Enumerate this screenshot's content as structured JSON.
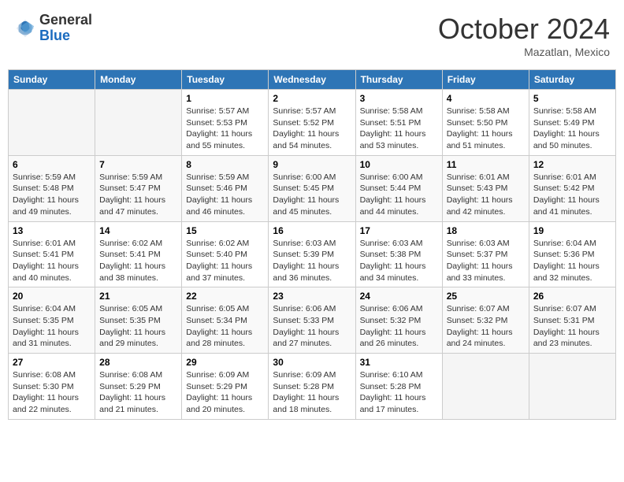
{
  "header": {
    "logo_general": "General",
    "logo_blue": "Blue",
    "month": "October 2024",
    "location": "Mazatlan, Mexico"
  },
  "columns": [
    "Sunday",
    "Monday",
    "Tuesday",
    "Wednesday",
    "Thursday",
    "Friday",
    "Saturday"
  ],
  "weeks": [
    [
      {
        "day": "",
        "info": ""
      },
      {
        "day": "",
        "info": ""
      },
      {
        "day": "1",
        "info": "Sunrise: 5:57 AM\nSunset: 5:53 PM\nDaylight: 11 hours and 55 minutes."
      },
      {
        "day": "2",
        "info": "Sunrise: 5:57 AM\nSunset: 5:52 PM\nDaylight: 11 hours and 54 minutes."
      },
      {
        "day": "3",
        "info": "Sunrise: 5:58 AM\nSunset: 5:51 PM\nDaylight: 11 hours and 53 minutes."
      },
      {
        "day": "4",
        "info": "Sunrise: 5:58 AM\nSunset: 5:50 PM\nDaylight: 11 hours and 51 minutes."
      },
      {
        "day": "5",
        "info": "Sunrise: 5:58 AM\nSunset: 5:49 PM\nDaylight: 11 hours and 50 minutes."
      }
    ],
    [
      {
        "day": "6",
        "info": "Sunrise: 5:59 AM\nSunset: 5:48 PM\nDaylight: 11 hours and 49 minutes."
      },
      {
        "day": "7",
        "info": "Sunrise: 5:59 AM\nSunset: 5:47 PM\nDaylight: 11 hours and 47 minutes."
      },
      {
        "day": "8",
        "info": "Sunrise: 5:59 AM\nSunset: 5:46 PM\nDaylight: 11 hours and 46 minutes."
      },
      {
        "day": "9",
        "info": "Sunrise: 6:00 AM\nSunset: 5:45 PM\nDaylight: 11 hours and 45 minutes."
      },
      {
        "day": "10",
        "info": "Sunrise: 6:00 AM\nSunset: 5:44 PM\nDaylight: 11 hours and 44 minutes."
      },
      {
        "day": "11",
        "info": "Sunrise: 6:01 AM\nSunset: 5:43 PM\nDaylight: 11 hours and 42 minutes."
      },
      {
        "day": "12",
        "info": "Sunrise: 6:01 AM\nSunset: 5:42 PM\nDaylight: 11 hours and 41 minutes."
      }
    ],
    [
      {
        "day": "13",
        "info": "Sunrise: 6:01 AM\nSunset: 5:41 PM\nDaylight: 11 hours and 40 minutes."
      },
      {
        "day": "14",
        "info": "Sunrise: 6:02 AM\nSunset: 5:41 PM\nDaylight: 11 hours and 38 minutes."
      },
      {
        "day": "15",
        "info": "Sunrise: 6:02 AM\nSunset: 5:40 PM\nDaylight: 11 hours and 37 minutes."
      },
      {
        "day": "16",
        "info": "Sunrise: 6:03 AM\nSunset: 5:39 PM\nDaylight: 11 hours and 36 minutes."
      },
      {
        "day": "17",
        "info": "Sunrise: 6:03 AM\nSunset: 5:38 PM\nDaylight: 11 hours and 34 minutes."
      },
      {
        "day": "18",
        "info": "Sunrise: 6:03 AM\nSunset: 5:37 PM\nDaylight: 11 hours and 33 minutes."
      },
      {
        "day": "19",
        "info": "Sunrise: 6:04 AM\nSunset: 5:36 PM\nDaylight: 11 hours and 32 minutes."
      }
    ],
    [
      {
        "day": "20",
        "info": "Sunrise: 6:04 AM\nSunset: 5:35 PM\nDaylight: 11 hours and 31 minutes."
      },
      {
        "day": "21",
        "info": "Sunrise: 6:05 AM\nSunset: 5:35 PM\nDaylight: 11 hours and 29 minutes."
      },
      {
        "day": "22",
        "info": "Sunrise: 6:05 AM\nSunset: 5:34 PM\nDaylight: 11 hours and 28 minutes."
      },
      {
        "day": "23",
        "info": "Sunrise: 6:06 AM\nSunset: 5:33 PM\nDaylight: 11 hours and 27 minutes."
      },
      {
        "day": "24",
        "info": "Sunrise: 6:06 AM\nSunset: 5:32 PM\nDaylight: 11 hours and 26 minutes."
      },
      {
        "day": "25",
        "info": "Sunrise: 6:07 AM\nSunset: 5:32 PM\nDaylight: 11 hours and 24 minutes."
      },
      {
        "day": "26",
        "info": "Sunrise: 6:07 AM\nSunset: 5:31 PM\nDaylight: 11 hours and 23 minutes."
      }
    ],
    [
      {
        "day": "27",
        "info": "Sunrise: 6:08 AM\nSunset: 5:30 PM\nDaylight: 11 hours and 22 minutes."
      },
      {
        "day": "28",
        "info": "Sunrise: 6:08 AM\nSunset: 5:29 PM\nDaylight: 11 hours and 21 minutes."
      },
      {
        "day": "29",
        "info": "Sunrise: 6:09 AM\nSunset: 5:29 PM\nDaylight: 11 hours and 20 minutes."
      },
      {
        "day": "30",
        "info": "Sunrise: 6:09 AM\nSunset: 5:28 PM\nDaylight: 11 hours and 18 minutes."
      },
      {
        "day": "31",
        "info": "Sunrise: 6:10 AM\nSunset: 5:28 PM\nDaylight: 11 hours and 17 minutes."
      },
      {
        "day": "",
        "info": ""
      },
      {
        "day": "",
        "info": ""
      }
    ]
  ]
}
